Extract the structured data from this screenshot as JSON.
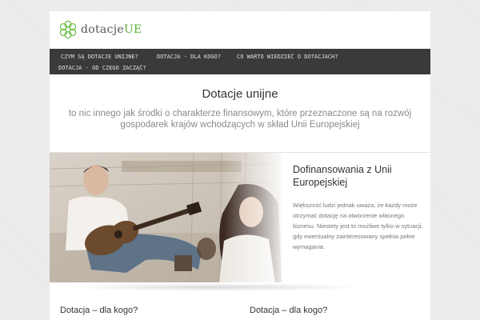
{
  "logo": {
    "text_main": "dotacje",
    "text_accent": "UE",
    "accent_color": "#5db53a"
  },
  "nav": {
    "items": [
      {
        "label": "CZYM SĄ DOTACJE UNIJNE?"
      },
      {
        "label": "DOTACJA - DLA KOGO?"
      },
      {
        "label": "CO WARTO WIEDZIEĆ O DOTACJACH?"
      },
      {
        "label": "DOTACJA - OD CZEGO ZACZĄĆ?"
      }
    ]
  },
  "hero": {
    "title": "Dotacje unijne",
    "subtitle": "to nic innego jak środki o charakterze finansowym, które przeznaczone są na rozwój gospodarek krajów wchodzących w skład Unii Europejskiej"
  },
  "feature": {
    "title": "Dofinansowania z Unii Europejskiej",
    "body": "Większość ludzi jednak uważa, że każdy może otrzymać dotację na otworzenie własnego biznesu. Niestety jest to możliwe tylko w sytuacji, gdy ewentualny zainteresowany spełnia pełne wymagania."
  },
  "sections": [
    {
      "title": "Dotacja – dla kogo?"
    },
    {
      "title": "Dotacja – dla kogo?"
    }
  ]
}
